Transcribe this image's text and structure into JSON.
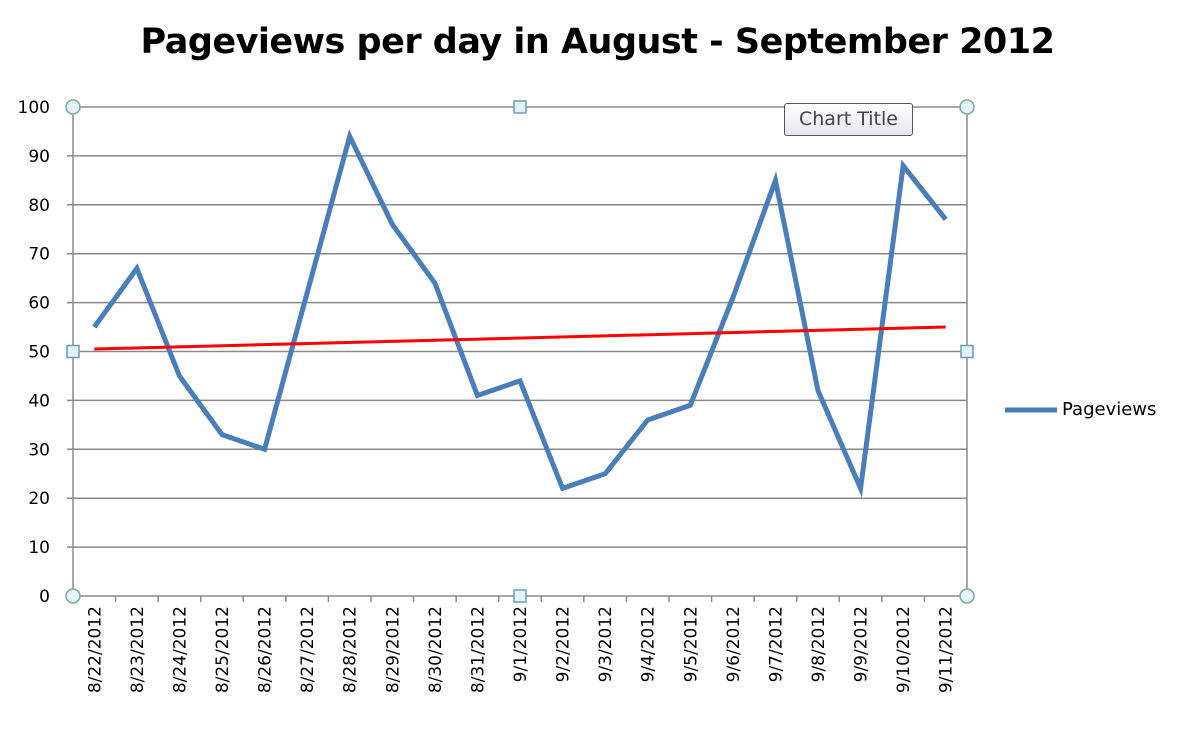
{
  "chart_data": {
    "type": "line",
    "title": "Pageviews per day in August - September 2012",
    "categories": [
      "8/22/2012",
      "8/23/2012",
      "8/24/2012",
      "8/25/2012",
      "8/26/2012",
      "8/27/2012",
      "8/28/2012",
      "8/29/2012",
      "8/30/2012",
      "8/31/2012",
      "9/1/2012",
      "9/2/2012",
      "9/3/2012",
      "9/4/2012",
      "9/5/2012",
      "9/6/2012",
      "9/7/2012",
      "9/8/2012",
      "9/9/2012",
      "9/10/2012",
      "9/11/2012"
    ],
    "series": [
      {
        "name": "Pageviews",
        "color": "#4a7ebb",
        "values": [
          55,
          67,
          45,
          33,
          30,
          62,
          94,
          76,
          64,
          41,
          44,
          22,
          25,
          36,
          39,
          61,
          85,
          42,
          22,
          88,
          77
        ]
      }
    ],
    "trendline": {
      "type": "linear",
      "color": "#ff0000",
      "start": 50.5,
      "end": 55
    },
    "ylim": [
      0,
      100
    ],
    "yticks": [
      0,
      10,
      20,
      30,
      40,
      50,
      60,
      70,
      80,
      90,
      100
    ],
    "grid": true,
    "legend": "right",
    "xlabel": "",
    "ylabel": ""
  },
  "tooltip": {
    "text": "Chart Title"
  }
}
